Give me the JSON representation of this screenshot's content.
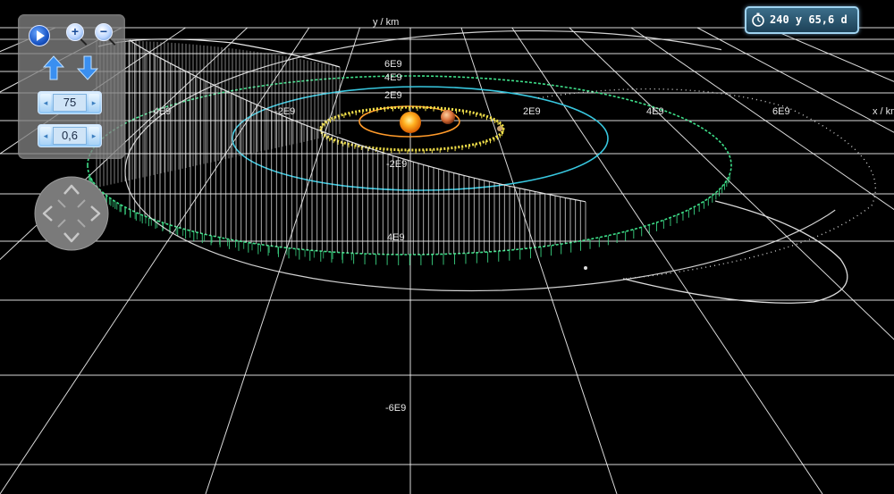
{
  "time_display": {
    "value": "240 y 65,6 d",
    "icon": "stopwatch-icon"
  },
  "controls": {
    "play_icon": "play-icon",
    "zoom_in_label": "+",
    "zoom_out_label": "−",
    "arrow_up_icon": "arrow-up-icon",
    "arrow_down_icon": "arrow-down-icon",
    "speed_value": "75",
    "scale_value": "0,6",
    "stepper_left": "◂",
    "stepper_right": "▸",
    "dpad_icon": "direction-pad-icon"
  },
  "axes": {
    "y_axis_label": "y / km",
    "x_axis_label": "x / km",
    "x_ticks": [
      {
        "label": "-4E9"
      },
      {
        "label": "-2E9"
      },
      {
        "label": "2E9"
      },
      {
        "label": "4E9"
      },
      {
        "label": "6E9"
      }
    ],
    "y_ticks": [
      {
        "label": "6E9"
      },
      {
        "label": "4E9"
      },
      {
        "label": "2E9"
      },
      {
        "label": "-2E9"
      },
      {
        "label": "4E9"
      },
      {
        "label": "-6E9"
      }
    ]
  },
  "colors": {
    "background": "#000000",
    "grid": "#ffffff",
    "sun": "#ff9a1a",
    "jupiter": "#d9703a",
    "orbit_orange": "#ff9a2a",
    "orbit_yellow": "#f2e04a",
    "orbit_cyan": "#38c8e0",
    "orbit_green": "#3ee08a",
    "orbit_comet": "#e8e8e8",
    "panel": "#808080"
  }
}
